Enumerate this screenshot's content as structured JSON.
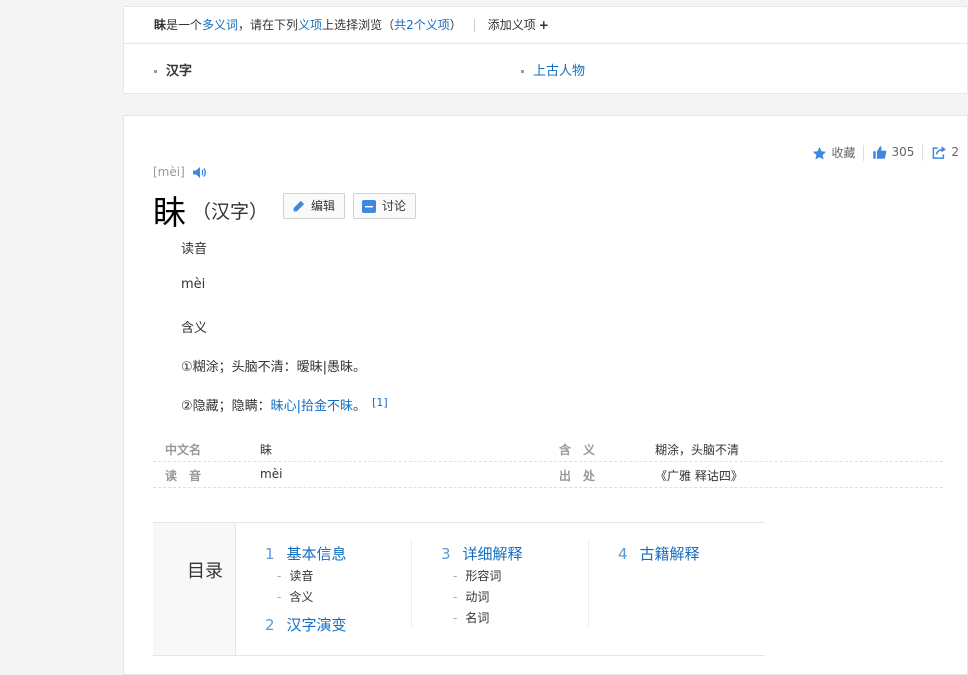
{
  "polysemy": {
    "word": "眛",
    "t1": "是一个",
    "link_polysemy": "多义词",
    "t2": "，请在下列",
    "link_item": "义项",
    "t3": "上选择浏览（",
    "link_count": "共2个义项",
    "t4": "）",
    "add_label": "添加义项",
    "add_plus": "+",
    "items": [
      {
        "label": "汉字",
        "current": true
      },
      {
        "label": "上古人物",
        "current": false
      }
    ]
  },
  "tools": {
    "favorite_label": "收藏",
    "like_count": "305",
    "share_count": "2"
  },
  "entry": {
    "pinyin": "[mèi]",
    "title": "眛",
    "subtitle": "（汉字）",
    "edit_label": "编辑",
    "discuss_label": "讨论"
  },
  "content": {
    "h_reading": "读音",
    "reading": "mèi",
    "h_meaning": "含义",
    "meaning1": "①糊涂；头脑不清：暧昧|愚昧。",
    "meaning2_text": "②隐藏；隐瞒：",
    "meaning2_link": "昧心|拾金不昧",
    "meaning2_end": "。",
    "ref": "[1]"
  },
  "basic_info": [
    {
      "name": "中文名",
      "value": "眛"
    },
    {
      "name": "含　义",
      "value": "糊涂，头脑不清"
    },
    {
      "name": "读　音",
      "value": "mèi"
    },
    {
      "name": "出　处",
      "value": "《广雅 释诂四》"
    }
  ],
  "catalog": {
    "title": "目录",
    "sections": [
      {
        "num": "1",
        "label": "基本信息",
        "subs": [
          "读音",
          "含义"
        ]
      },
      {
        "num": "2",
        "label": "汉字演变",
        "subs": []
      },
      {
        "num": "3",
        "label": "详细解释",
        "subs": [
          "形容词",
          "动词",
          "名词"
        ]
      },
      {
        "num": "4",
        "label": "古籍解释",
        "subs": []
      }
    ]
  },
  "colors": {
    "link": "#136ec2",
    "accent_icon": "#3f88e0"
  }
}
